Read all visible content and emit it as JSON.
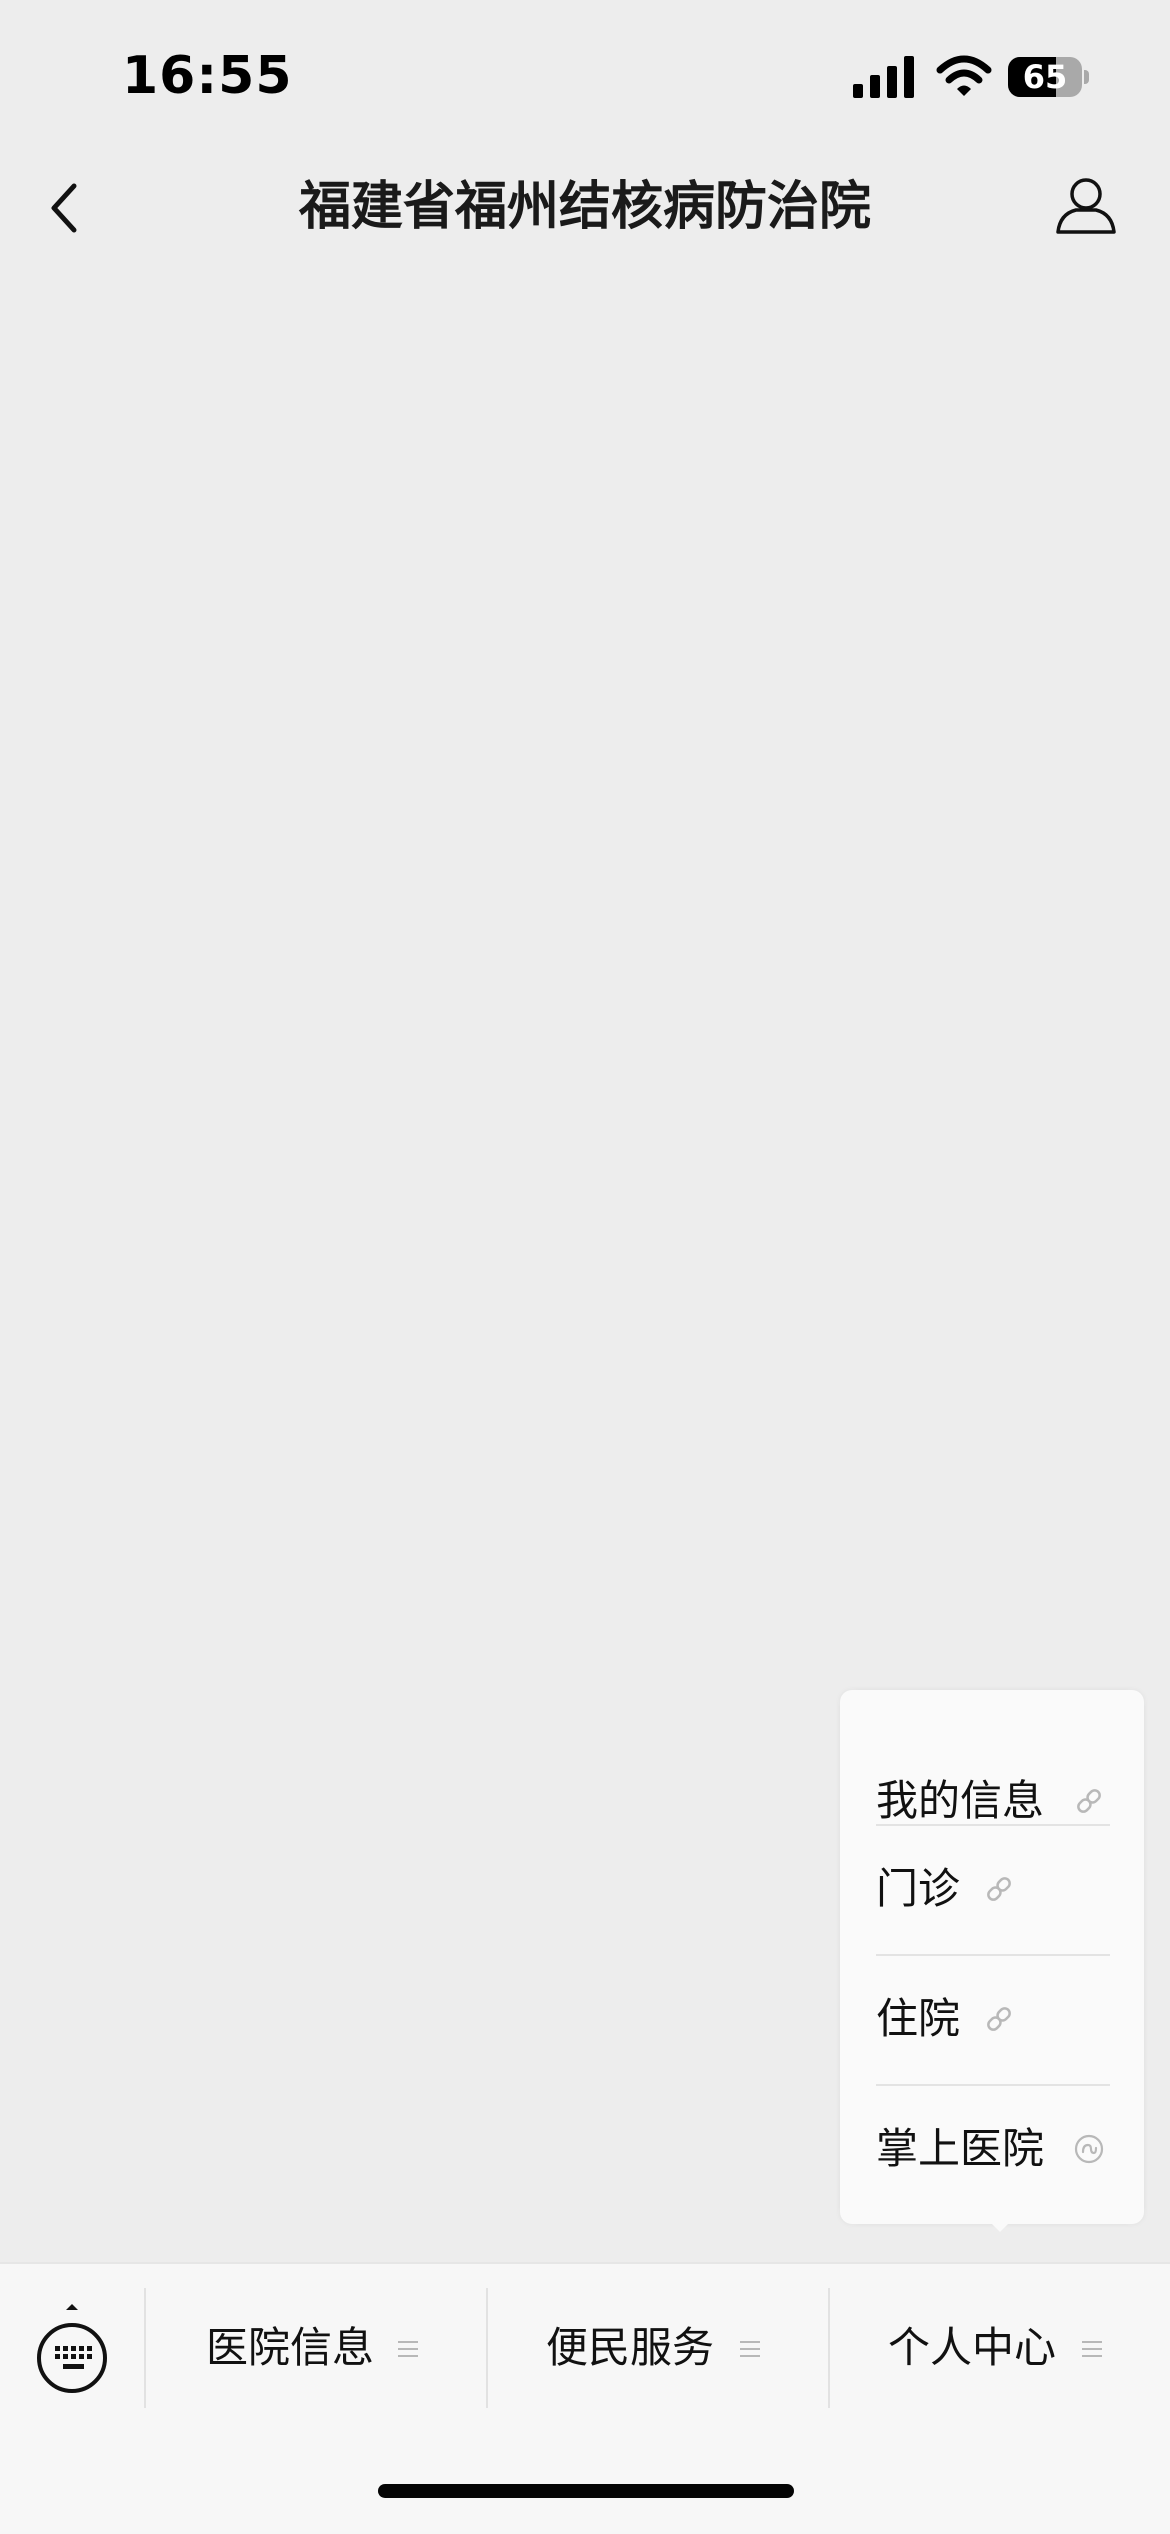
{
  "status_bar": {
    "time": "16:55",
    "battery_level": "65",
    "icons": [
      "signal-icon",
      "wifi-icon",
      "battery-icon"
    ]
  },
  "nav": {
    "title": "福建省福州结核病防治院",
    "icons": [
      "back-icon",
      "profile-icon"
    ]
  },
  "popup_menu": {
    "items": [
      {
        "label": "我的信息",
        "icon": "link-icon"
      },
      {
        "label": "门诊",
        "icon": "link-icon"
      },
      {
        "label": "住院",
        "icon": "link-icon"
      },
      {
        "label": "掌上医院",
        "icon": "mini-program-icon"
      }
    ]
  },
  "bottom_menu": {
    "keyboard_icon": "keyboard-icon",
    "tabs": [
      {
        "label": "医院信息",
        "icon": "menu-lines-icon"
      },
      {
        "label": "便民服务",
        "icon": "menu-lines-icon"
      },
      {
        "label": "个人中心",
        "icon": "menu-lines-icon"
      }
    ]
  },
  "colors": {
    "background": "#ededed",
    "bottom_bar": "#f7f7f7",
    "popup": "#fafafa",
    "text": "#111111",
    "icon_grey": "#b8b8b8"
  }
}
